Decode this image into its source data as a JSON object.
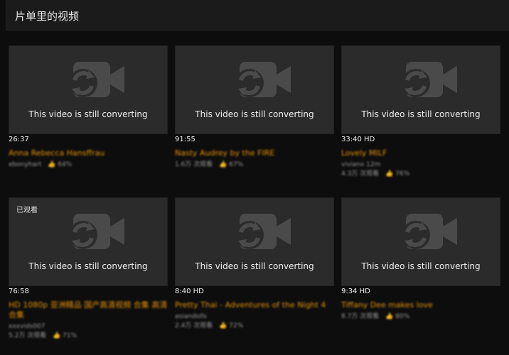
{
  "header": {
    "title": "片单里的视频"
  },
  "placeholder_text": "This video is still converting",
  "videos": [
    {
      "duration": "26:37",
      "watched_label": "",
      "title": "Anna Rebecca Hansffrau",
      "uploader": "ebonyhart",
      "views": "",
      "rating": "64%"
    },
    {
      "duration": "91:55",
      "watched_label": "",
      "title": "Nasty Audrey by the FIRE",
      "uploader": "",
      "views": "1.6万 次观看",
      "rating": "67%"
    },
    {
      "duration": "33:40 HD",
      "watched_label": "",
      "title": "Lovely MILF",
      "uploader": "vivianx 12m",
      "views": "4.3万 次观看",
      "rating": "76%"
    },
    {
      "duration": "76:58",
      "watched_label": "已观看",
      "title": "HD 1080p 亚洲精品 国产高清视频 合集 高清合集",
      "uploader": "xxxvids007",
      "views": "5.2万 次观看",
      "rating": "71%"
    },
    {
      "duration": "8:40 HD",
      "watched_label": "",
      "title": "Pretty Thai - Adventures of the Night 4",
      "uploader": "asiandolls",
      "views": "2.4万 次观看",
      "rating": "72%"
    },
    {
      "duration": "9:34 HD",
      "watched_label": "",
      "title": "Tiffany Dee makes love",
      "uploader": "",
      "views": "8.7万 次观看",
      "rating": "80%"
    }
  ]
}
